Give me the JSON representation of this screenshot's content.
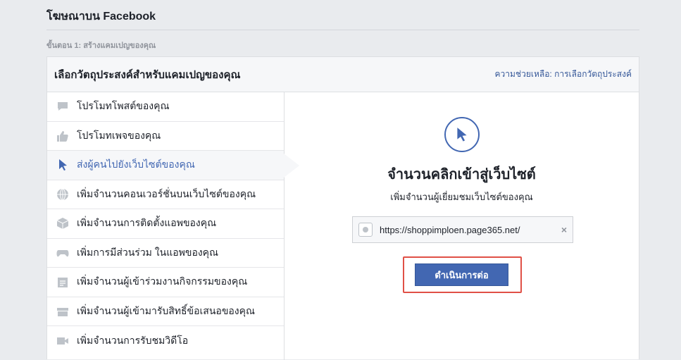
{
  "header": {
    "title": "โฆษณาบน Facebook",
    "step": "ขั้นตอน 1: สร้างแคมเปญของคุณ"
  },
  "panel": {
    "title": "เลือกวัตถุประสงค์สำหรับแคมเปญของคุณ",
    "help_link": "ความช่วยเหลือ: การเลือกวัตถุประสงค์"
  },
  "objectives": [
    {
      "label": "โปรโมทโพสต์ของคุณ",
      "icon": "post-icon"
    },
    {
      "label": "โปรโมทเพจของคุณ",
      "icon": "like-icon"
    },
    {
      "label": "ส่งผู้คนไปยังเว็บไซต์ของคุณ",
      "icon": "cursor-icon",
      "selected": true
    },
    {
      "label": "เพิ่มจำนวนคอนเวอร์ชั่นบนเว็บไซต์ของคุณ",
      "icon": "globe-icon"
    },
    {
      "label": "เพิ่มจำนวนการติดตั้งแอพของคุณ",
      "icon": "box-icon"
    },
    {
      "label": "เพิ่มการมีส่วนร่วม ในแอพของคุณ",
      "icon": "gamepad-icon"
    },
    {
      "label": "เพิ่มจำนวนผู้เข้าร่วมงานกิจกรรมของคุณ",
      "icon": "calendar-icon"
    },
    {
      "label": "เพิ่มจำนวนผู้เข้ามารับสิทธิ์ข้อเสนอของคุณ",
      "icon": "offer-icon"
    },
    {
      "label": "เพิ่มจำนวนการรับชมวิดีโอ",
      "icon": "video-icon"
    }
  ],
  "detail": {
    "icon": "cursor-icon",
    "title": "จำนวนคลิกเข้าสู่เว็บไซต์",
    "subtitle": "เพิ่มจำนวนผู้เยี่ยมชมเว็บไซต์ของคุณ",
    "url": "https://shoppimploen.page365.net/",
    "clear": "×",
    "continue_label": "ดำเนินการต่อ"
  },
  "colors": {
    "accent": "#4267b2",
    "highlight": "#e05046",
    "background": "#e9ebee"
  }
}
